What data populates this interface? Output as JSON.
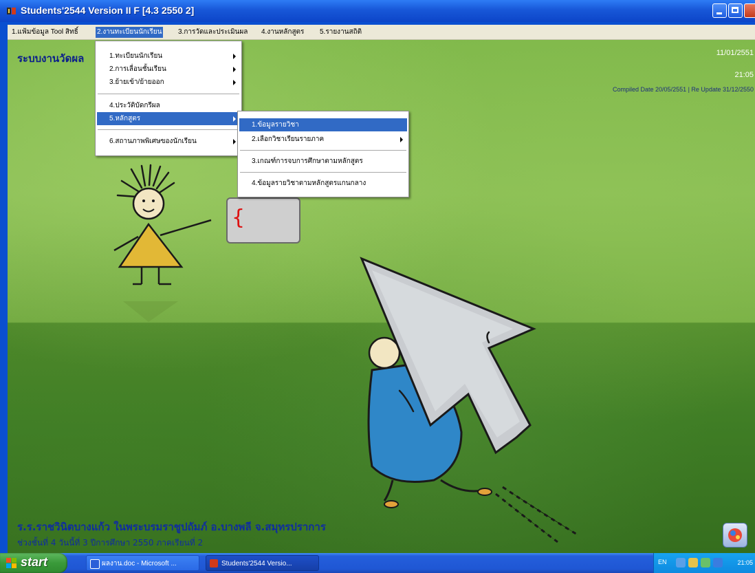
{
  "window": {
    "title": "Students'2544 Version II F [4.3 2550 2]"
  },
  "menubar": {
    "items": [
      {
        "label": "1.แฟ้มข้อมูล Tool สิทธิ์"
      },
      {
        "label": "2.งานทะเบียนนักเรียน"
      },
      {
        "label": "3.การวัดและประเมินผล"
      },
      {
        "label": "4.งานหลักสูตร"
      },
      {
        "label": "5.รายงานสถิติ"
      }
    ]
  },
  "dropdown_main": {
    "items": [
      {
        "label": "1.ทะเบียนนักเรียน"
      },
      {
        "label": "2.การเลื่อนชั้นเรียน"
      },
      {
        "label": "3.ย้ายเข้า/ย้ายออก"
      },
      {
        "label": "4.ประวัติบัดกรีผล"
      },
      {
        "label": "5.หลักสูตร"
      },
      {
        "label": "6.สถานภาพพิเศษของนักเรียน"
      }
    ]
  },
  "dropdown_sub": {
    "items": [
      {
        "label": "1.ข้อมูลรายวิชา"
      },
      {
        "label": "2.เลือกวิชาเรียนรายภาค"
      },
      {
        "label": "3.เกณฑ์การจบการศึกษาตามหลักสูตร"
      },
      {
        "label": "4.ข้อมูลรายวิชาตามหลักสูตรแกนกลาง"
      }
    ]
  },
  "content": {
    "heading": "ระบบงานวัดผล",
    "date": "11/01/2551",
    "time": "21:05",
    "compiled": "Compiled Date 20/05/2551 | Re Update 31/12/2550",
    "footer_line1": "ร.ร.ราชวินิตบางแก้ว ในพระบรมราชูปถัมภ์  อ.บางพลี  จ.สมุทรปราการ",
    "footer_line2": "ช่วงชั้นที่ 4  วันนี้ที่ 3  ปีการศึกษา 2550  ภาคเรียนที่ 2"
  },
  "taskbar": {
    "start_label": "start",
    "task1": "ผลงาน.doc - Microsoft ...",
    "task2": "Students'2544 Versio...",
    "lang": "EN",
    "clock": "21:05"
  },
  "colors": {
    "title_bar": "#1857d8",
    "menu_highlight": "#316ac5",
    "menubar_bg": "#ece9d8",
    "heading_text": "#0b1f8a",
    "footer_text": "#0f2d9e"
  }
}
